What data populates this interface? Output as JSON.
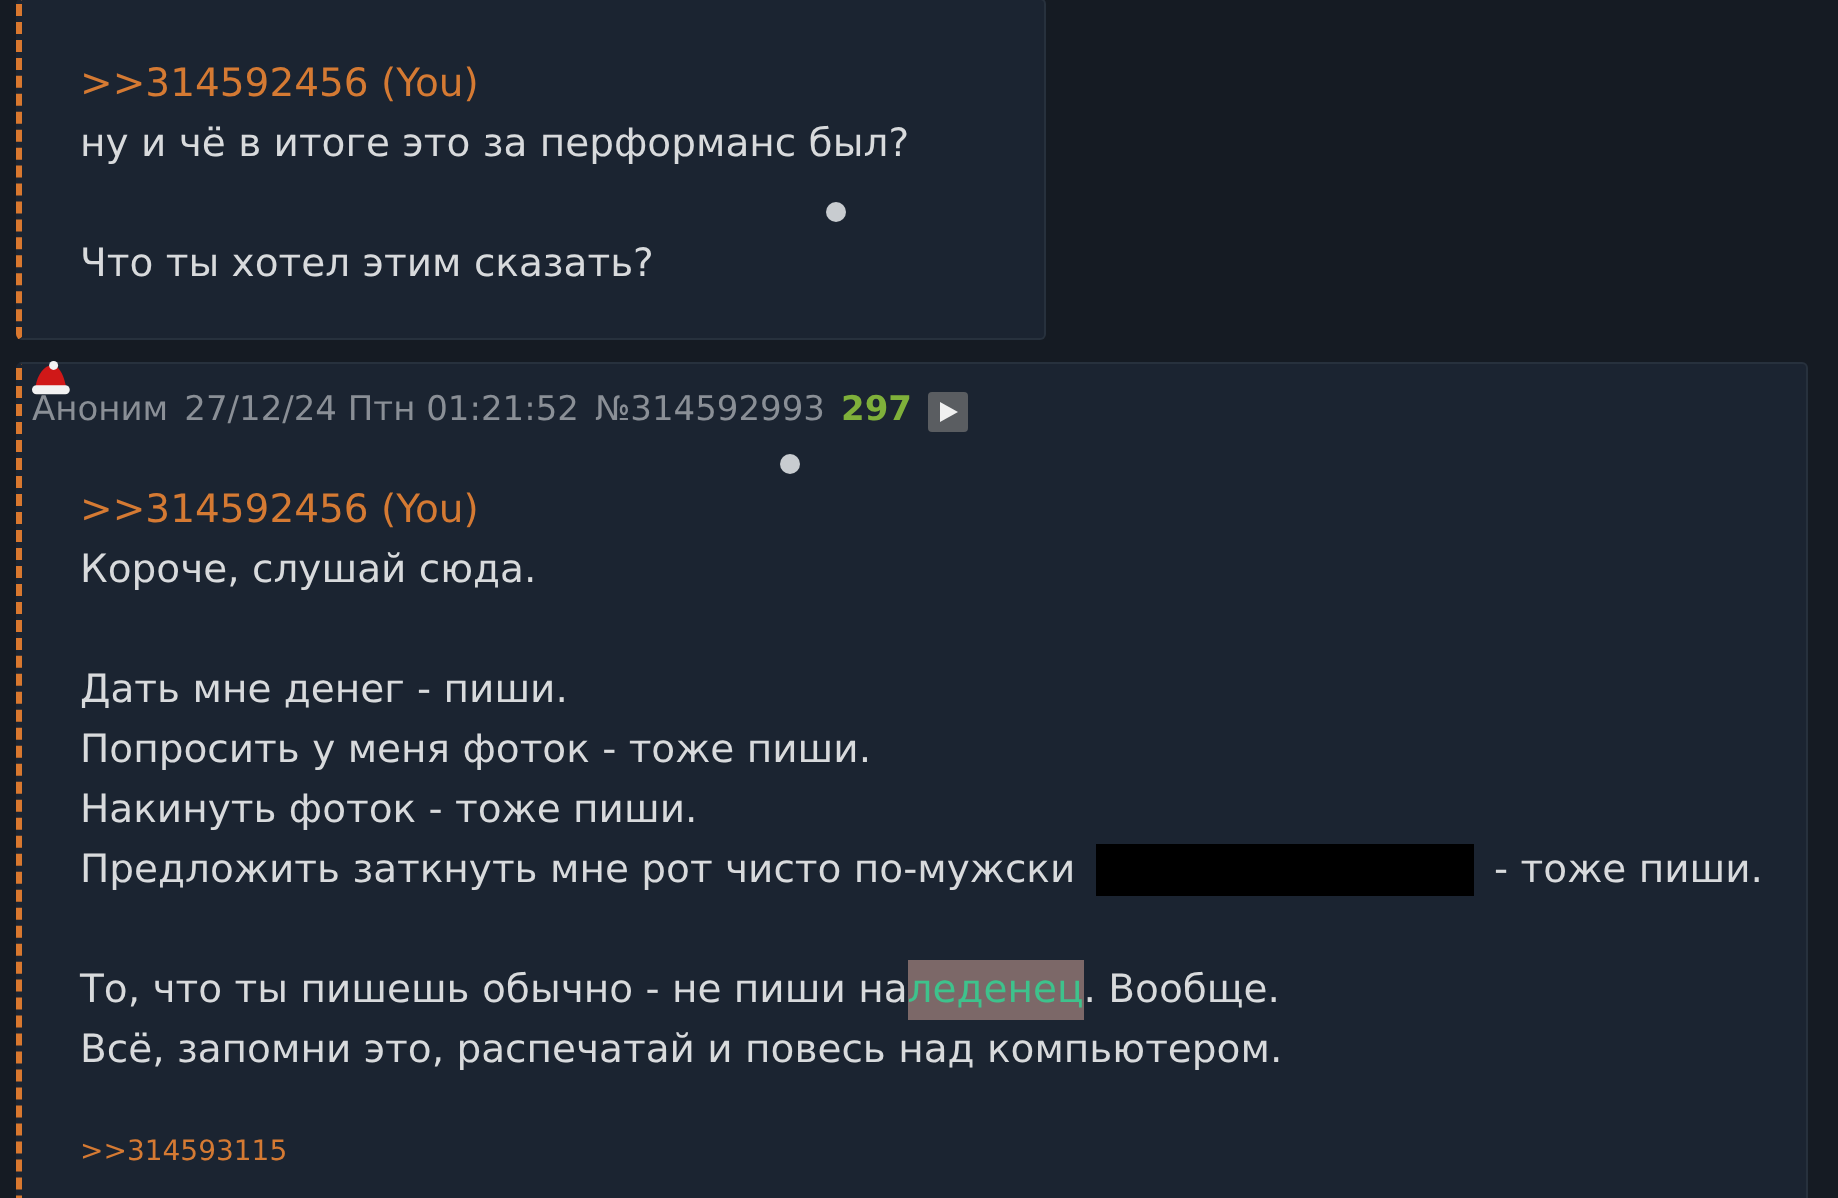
{
  "posts": [
    {
      "reply_to": ">>314592456 (You)",
      "paragraphs": [
        [
          {
            "segments": [
              {
                "kind": "text",
                "text": "ну и чё в итоге это за перформанс был?"
              }
            ]
          }
        ],
        [
          {
            "segments": [
              {
                "kind": "text",
                "text": "Что ты хотел этим сказать?"
              }
            ]
          }
        ]
      ]
    },
    {
      "header": {
        "name": "Аноним",
        "date": "27/12/24 Птн 01:21:52",
        "number": "№314592993",
        "count": "297"
      },
      "reply_to": ">>314592456 (You)",
      "paragraphs": [
        [
          {
            "segments": [
              {
                "kind": "text",
                "text": "Короче, слушай сюда."
              }
            ]
          }
        ],
        [
          {
            "segments": [
              {
                "kind": "text",
                "text": "Дать мне денег - пиши."
              }
            ]
          },
          {
            "segments": [
              {
                "kind": "text",
                "text": "Попросить у меня фоток - тоже пиши."
              }
            ]
          },
          {
            "segments": [
              {
                "kind": "text",
                "text": "Накинуть фоток - тоже пиши."
              }
            ]
          },
          {
            "segments": [
              {
                "kind": "text",
                "text": "Предложить заткнуть мне рот чисто по-мужски "
              },
              {
                "kind": "spoiler"
              },
              {
                "kind": "text",
                "text": " - тоже пиши."
              }
            ]
          }
        ],
        [
          {
            "segments": [
              {
                "kind": "text",
                "text": "То, что ты пишешь обычно - не пиши на"
              },
              {
                "kind": "filtered",
                "text": "леденец"
              },
              {
                "kind": "text",
                "text": ". Вообще."
              }
            ]
          },
          {
            "segments": [
              {
                "kind": "text",
                "text": "Всё, запомни это, распечатай и повесь над компьютером."
              }
            ]
          }
        ]
      ],
      "replies": [
        ">>314593115"
      ]
    }
  ]
}
